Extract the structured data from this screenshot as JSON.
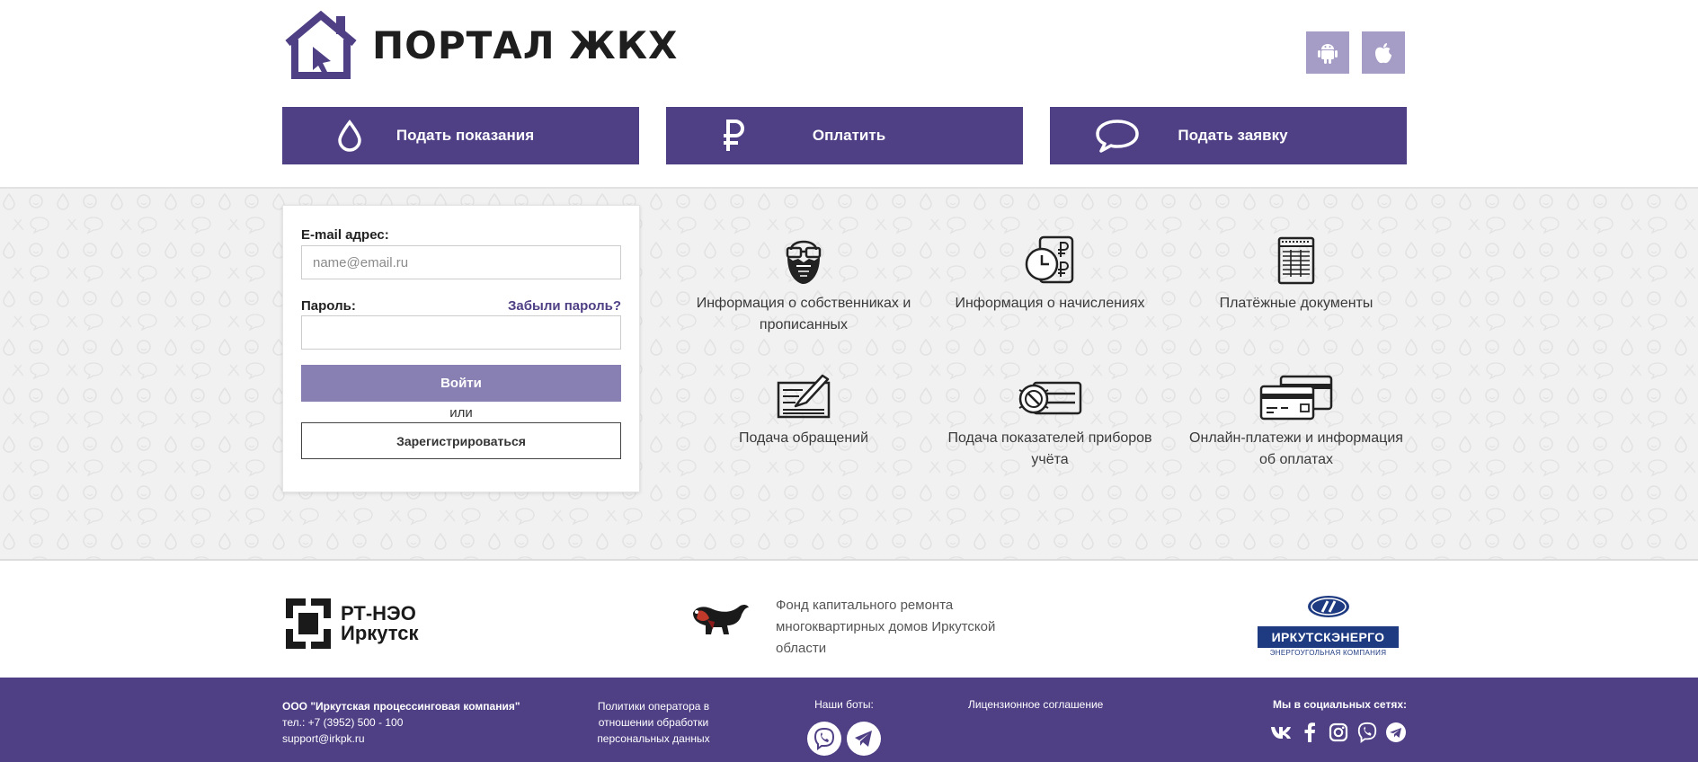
{
  "header": {
    "logo_text": "ПОРТАЛ ЖКХ",
    "app_buttons": [
      {
        "icon": "android-icon"
      },
      {
        "icon": "apple-icon"
      }
    ],
    "actions": [
      {
        "label": "Подать показания",
        "icon": "drop-icon"
      },
      {
        "label": "Оплатить",
        "icon": "ruble-icon"
      },
      {
        "label": "Подать заявку",
        "icon": "chat-bubble-icon"
      }
    ]
  },
  "login": {
    "email_label": "E-mail адрес:",
    "email_placeholder": "name@email.ru",
    "email_value": "",
    "password_label": "Пароль:",
    "forgot_link": "Забыли пароль?",
    "login_button": "Войти",
    "or_text": "или",
    "register_button": "Зарегистрироваться"
  },
  "features": [
    {
      "text": "Информация о собственниках и прописанных",
      "icon": "bearded-man-icon"
    },
    {
      "text": "Информация о начислениях",
      "icon": "clock-ruble-icon"
    },
    {
      "text": "Платёжные документы",
      "icon": "document-icon"
    },
    {
      "text": "Подача обращений",
      "icon": "writing-letter-icon"
    },
    {
      "text": "Подача показателей приборов учёта",
      "icon": "meter-icon"
    },
    {
      "text": "Онлайн-платежи и информация об оплатах",
      "icon": "credit-cards-icon"
    }
  ],
  "partners": {
    "rt_line1": "РТ-НЭО",
    "rt_line2": "Иркутск",
    "fund_text": "Фонд капитального ремонта многоквартирных домов Иркутской области",
    "irk_name": "ИРКУТСКЭНЕРГО",
    "irk_sub": "ЭНЕРГОУГОЛЬНАЯ КОМПАНИЯ"
  },
  "footer": {
    "company_name": "ООО \"Иркутская процессинговая компания\"",
    "phone": "тел.: +7 (3952) 500 - 100",
    "email": "support@irkpk.ru",
    "policy_line1": "Политики оператора в",
    "policy_line2": "отношении обработки",
    "policy_line3": "персональных данных",
    "bots_label": "Наши боты:",
    "license": "Лицензионное соглашение",
    "social_label": "Мы в социальных сетях:"
  },
  "colors": {
    "brand": "#4f3f85",
    "login_button": "#8880b2",
    "app_button": "#a69dc7"
  }
}
